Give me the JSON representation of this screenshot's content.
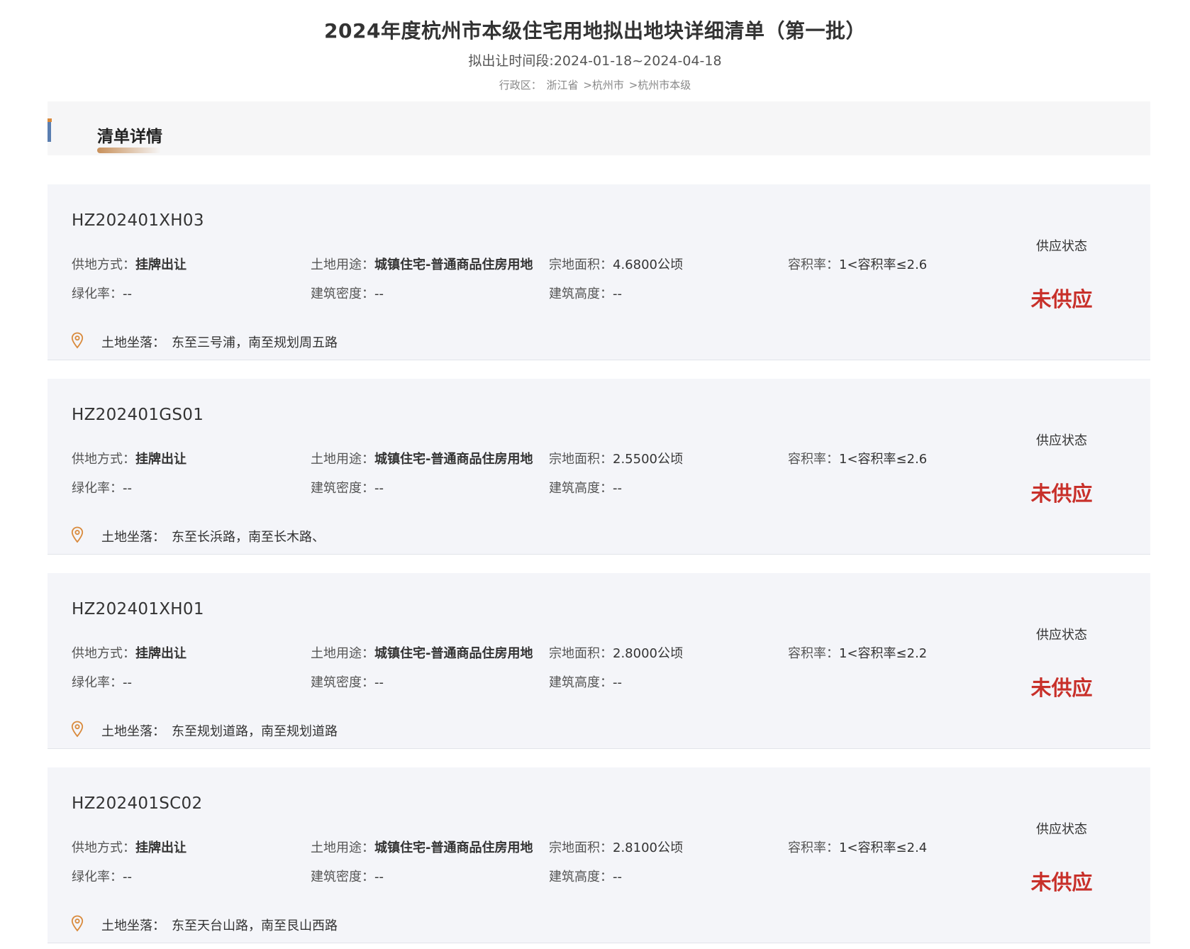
{
  "header": {
    "title": "2024年度杭州市本级住宅用地拟出地块详细清单（第一批）",
    "period_label": "拟出让时间段:",
    "period_value": "2024-01-18~2024-04-18",
    "region_label": "行政区：",
    "region_path": [
      "浙江省",
      ">杭州市",
      ">杭州市本级"
    ]
  },
  "section": {
    "title": "清单详情"
  },
  "labels": {
    "supply_method": "供地方式：",
    "land_use": "土地用途：",
    "area": "宗地面积：",
    "far": "容积率：",
    "green_ratio": "绿化率：",
    "building_density": "建筑密度：",
    "building_height": "建筑高度：",
    "location": "土地坐落：",
    "status_label": "供应状态"
  },
  "plots": [
    {
      "id": "HZ202401XH03",
      "supply_method": "挂牌出让",
      "land_use": "城镇住宅-普通商品住房用地",
      "area": "4.6800公顷",
      "far": "1<容积率≤2.6",
      "green_ratio": "--",
      "building_density": "--",
      "building_height": "--",
      "location": "东至三号浦，南至规划周五路",
      "status": "未供应"
    },
    {
      "id": "HZ202401GS01",
      "supply_method": "挂牌出让",
      "land_use": "城镇住宅-普通商品住房用地",
      "area": "2.5500公顷",
      "far": "1<容积率≤2.6",
      "green_ratio": "--",
      "building_density": "--",
      "building_height": "--",
      "location": "东至长浜路，南至长木路、",
      "status": "未供应"
    },
    {
      "id": "HZ202401XH01",
      "supply_method": "挂牌出让",
      "land_use": "城镇住宅-普通商品住房用地",
      "area": "2.8000公顷",
      "far": "1<容积率≤2.2",
      "green_ratio": "--",
      "building_density": "--",
      "building_height": "--",
      "location": "东至规划道路，南至规划道路",
      "status": "未供应"
    },
    {
      "id": "HZ202401SC02",
      "supply_method": "挂牌出让",
      "land_use": "城镇住宅-普通商品住房用地",
      "area": "2.8100公顷",
      "far": "1<容积率≤2.4",
      "green_ratio": "--",
      "building_density": "--",
      "building_height": "--",
      "location": "东至天台山路，南至艮山西路",
      "status": "未供应"
    }
  ],
  "colors": {
    "status_red": "#c8302a",
    "accent_blue": "#5a7eb0",
    "accent_orange": "#d98a3c",
    "card_bg": "#f4f5f9"
  },
  "icons": {
    "location": "location-pin-icon"
  }
}
